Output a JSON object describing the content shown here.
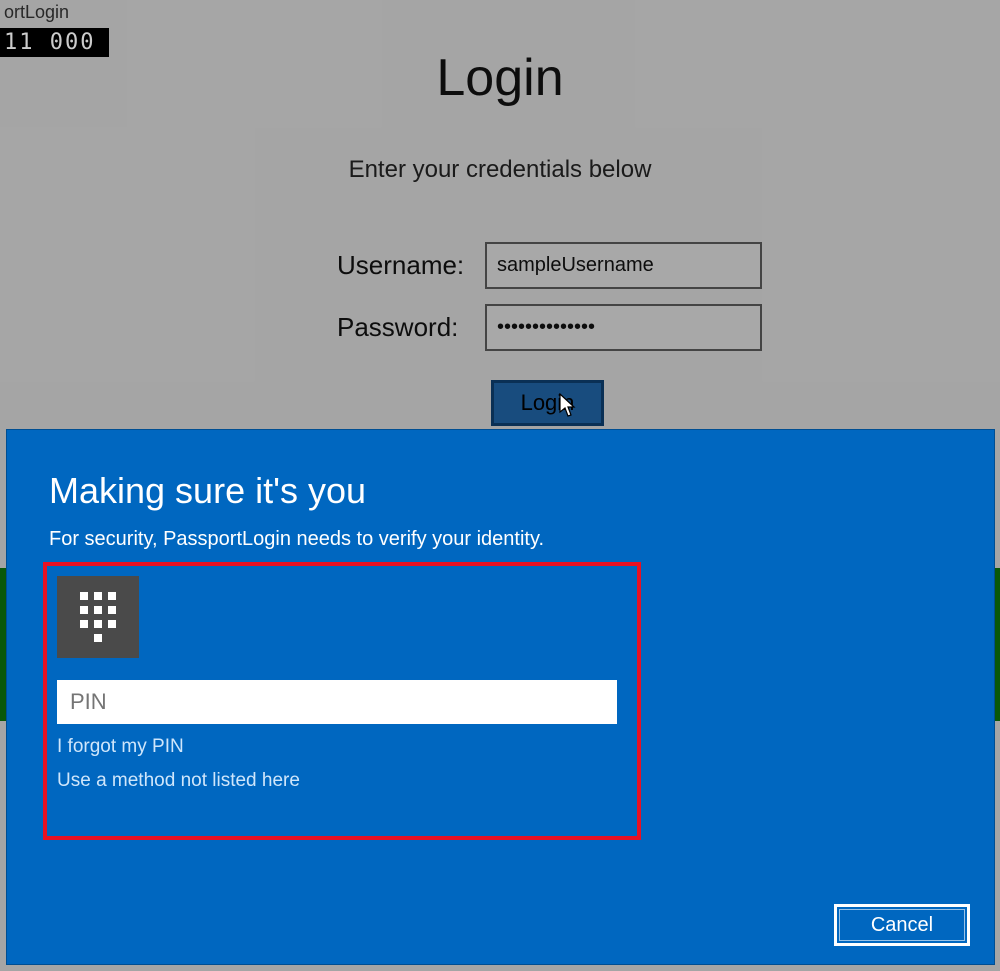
{
  "window": {
    "title_fragment": "ortLogin",
    "counter": "11  000"
  },
  "login": {
    "heading": "Login",
    "subheading": "Enter your credentials below",
    "username_label": "Username:",
    "username_value": "sampleUsername",
    "password_label": "Password:",
    "password_value": "••••••••••••••",
    "login_button": "Login"
  },
  "hello": {
    "title": "Making sure it's you",
    "subtitle": "For security, PassportLogin needs to verify your identity.",
    "pin_placeholder": "PIN",
    "forgot_link": "I forgot my PIN",
    "other_method_link": "Use a method not listed here",
    "cancel_button": "Cancel"
  }
}
